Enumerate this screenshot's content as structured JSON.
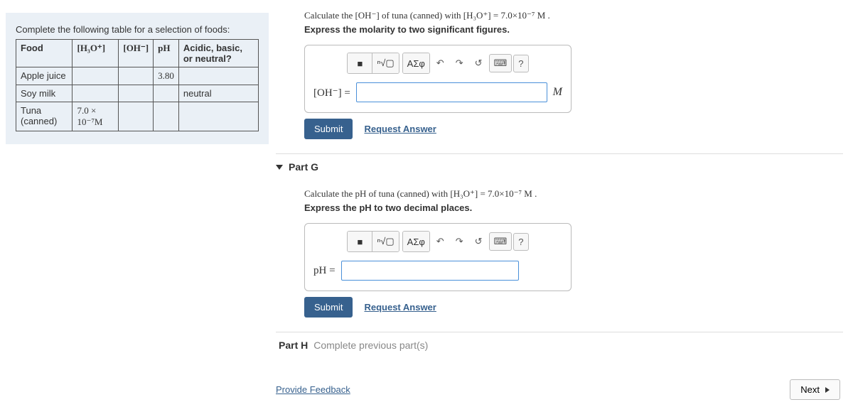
{
  "left": {
    "caption": "Complete the following table for a selection of foods:",
    "headers": {
      "food": "Food",
      "h3o": "[H₃O⁺]",
      "oh": "[OH⁻]",
      "ph": "pH",
      "abn": "Acidic, basic, or neutral?"
    },
    "rows": [
      {
        "food": "Apple juice",
        "h3o": "",
        "oh": "",
        "ph": "3.80",
        "abn": ""
      },
      {
        "food": "Soy milk",
        "h3o": "",
        "oh": "",
        "ph": "",
        "abn": "neutral"
      },
      {
        "food": "Tuna (canned)",
        "h3o": "7.0 × 10⁻⁷M",
        "oh": "",
        "ph": "",
        "abn": ""
      }
    ]
  },
  "partF": {
    "prompt": "Calculate the [OH⁻] of tuna (canned) with [H₃O⁺] = 7.0×10⁻⁷ M .",
    "instr": "Express the molarity to two significant figures.",
    "answer_label": "[OH⁻] =",
    "unit": "M",
    "submit": "Submit",
    "request": "Request Answer"
  },
  "partG": {
    "title": "Part G",
    "prompt": "Calculate the pH of tuna (canned) with [H₃O⁺] = 7.0×10⁻⁷ M .",
    "instr": "Express the pH to two decimal places.",
    "answer_label": "pH =",
    "submit": "Submit",
    "request": "Request Answer"
  },
  "partH": {
    "title": "Part H",
    "note": "Complete previous part(s)"
  },
  "toolbar": {
    "templates": "■",
    "sqrt": "ⁿ√▢",
    "greek": "ΑΣφ",
    "undo": "↶",
    "redo": "↷",
    "reset": "↺",
    "keyboard": "⌨",
    "help": "?"
  },
  "footer": {
    "feedback": "Provide Feedback",
    "next": "Next"
  }
}
